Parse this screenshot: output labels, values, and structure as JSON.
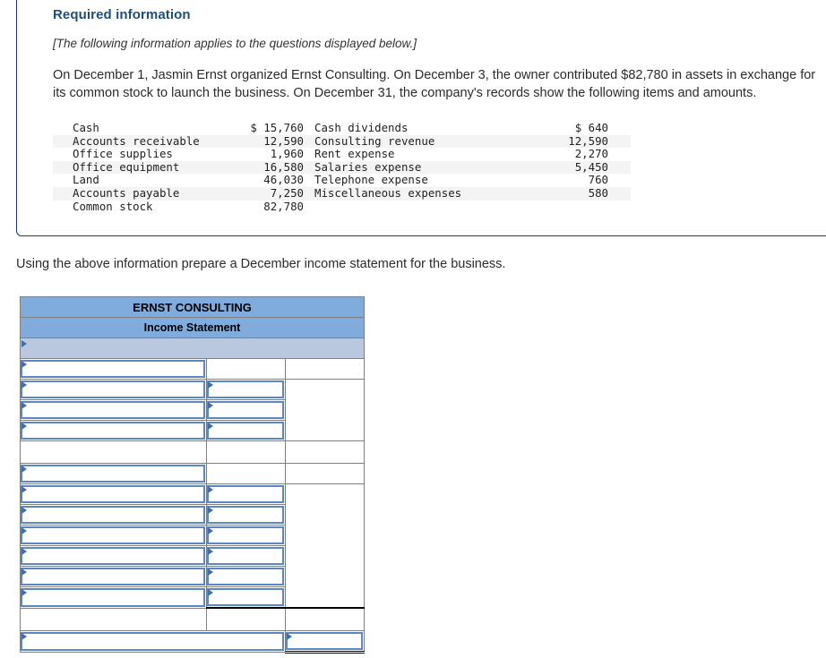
{
  "panel": {
    "title": "Required information",
    "subtitle": "[The following information applies to the questions displayed below.]",
    "body": "On December 1, Jasmin Ernst organized Ernst Consulting. On December 3, the owner contributed $82,780 in assets in exchange for its common stock to launch the business. On December 31, the company's records show the following items and amounts."
  },
  "trial_balance": {
    "left": [
      {
        "name": "Cash",
        "value": "$ 15,760"
      },
      {
        "name": "Accounts receivable",
        "value": "12,590"
      },
      {
        "name": "Office supplies",
        "value": "1,960"
      },
      {
        "name": "Office equipment",
        "value": "16,580"
      },
      {
        "name": "Land",
        "value": "46,030"
      },
      {
        "name": "Accounts payable",
        "value": "7,250"
      },
      {
        "name": "Common stock",
        "value": "82,780"
      }
    ],
    "right": [
      {
        "name": "Cash dividends",
        "value": "$ 640"
      },
      {
        "name": "Consulting revenue",
        "value": "12,590"
      },
      {
        "name": "Rent expense",
        "value": "2,270"
      },
      {
        "name": "Salaries expense",
        "value": "5,450"
      },
      {
        "name": "Telephone expense",
        "value": "760"
      },
      {
        "name": "Miscellaneous expenses",
        "value": "580"
      },
      {
        "name": "",
        "value": ""
      }
    ]
  },
  "instruction": "Using the above information prepare a December income statement for the business.",
  "worksheet": {
    "company": "ERNST CONSULTING",
    "statement": "Income Statement",
    "subheader": "",
    "rows": [
      {
        "kind": "field-a",
        "a": "",
        "b": "",
        "c": ""
      },
      {
        "kind": "field-ab",
        "a": "",
        "b": "",
        "c": ""
      },
      {
        "kind": "field-ab",
        "a": "",
        "b": "",
        "c": ""
      },
      {
        "kind": "field-ab",
        "a": "",
        "b": "",
        "c": ""
      },
      {
        "kind": "spacer",
        "a": "",
        "b": "",
        "c": ""
      },
      {
        "kind": "field-a",
        "a": "",
        "b": "",
        "c": ""
      },
      {
        "kind": "field-ab",
        "a": "",
        "b": "",
        "c": ""
      },
      {
        "kind": "field-ab",
        "a": "",
        "b": "",
        "c": ""
      },
      {
        "kind": "field-ab",
        "a": "",
        "b": "",
        "c": ""
      },
      {
        "kind": "field-ab",
        "a": "",
        "b": "",
        "c": ""
      },
      {
        "kind": "field-ab",
        "a": "",
        "b": "",
        "c": ""
      },
      {
        "kind": "field-ab-subtotal",
        "a": "",
        "b": "",
        "c": ""
      },
      {
        "kind": "spacer-total",
        "a": "",
        "b": "",
        "c": ""
      },
      {
        "kind": "field-ac-total",
        "a": "",
        "b": "",
        "c": ""
      }
    ]
  },
  "colors": {
    "panel_border": "#1f3864",
    "heading": "#1f4e79",
    "header_blue": "#7FABDD",
    "subheader_blue": "#B9C8DE",
    "field_border": "#5B87C5",
    "marker": "#3F6DB0",
    "grid": "#808080"
  }
}
